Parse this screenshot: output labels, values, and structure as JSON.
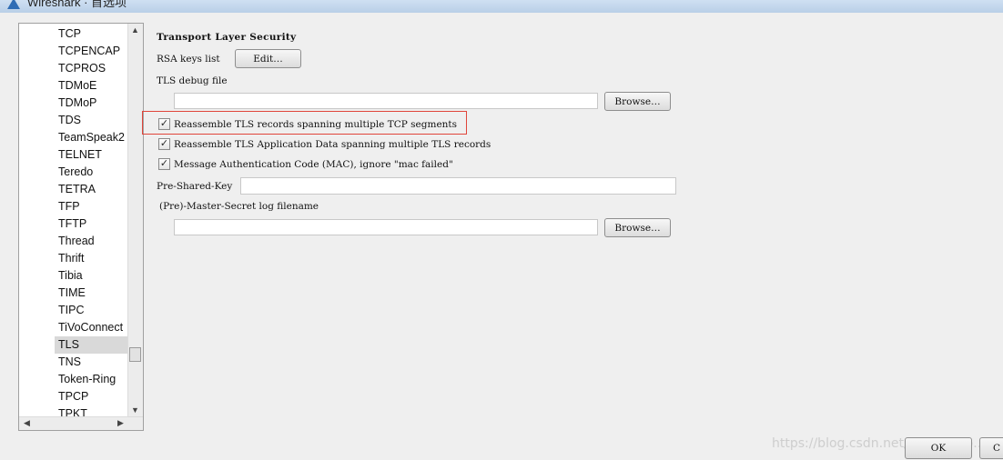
{
  "window": {
    "title": "Wireshark · 首选项"
  },
  "tree": {
    "items": [
      "TCP",
      "TCPENCAP",
      "TCPROS",
      "TDMoE",
      "TDMoP",
      "TDS",
      "TeamSpeak2",
      "TELNET",
      "Teredo",
      "TETRA",
      "TFP",
      "TFTP",
      "Thread",
      "Thrift",
      "Tibia",
      "TIME",
      "TIPC",
      "TiVoConnect",
      "TLS",
      "TNS",
      "Token-Ring",
      "TPCP",
      "TPKT"
    ],
    "selected": "TLS"
  },
  "panel": {
    "title": "Transport Layer Security",
    "rsa_label": "RSA keys list",
    "edit_button": "Edit…",
    "debug_file_label": "TLS debug file",
    "debug_file_value": "",
    "browse_button_1": "Browse…",
    "checkbox_1_label": "Reassemble TLS records spanning multiple TCP segments",
    "checkbox_1_checked": true,
    "checkbox_2_label": "Reassemble TLS Application Data spanning multiple TLS records",
    "checkbox_2_checked": true,
    "checkbox_3_label": "Message Authentication Code (MAC), ignore \"mac failed\"",
    "checkbox_3_checked": true,
    "psk_label": "Pre-Shared-Key",
    "psk_value": "",
    "master_secret_label": "(Pre)-Master-Secret log filename",
    "master_secret_value": "",
    "browse_button_2": "Browse…"
  },
  "footer": {
    "ok_button": "OK",
    "cancel_button": "C",
    "watermark": "https://blog.csdn.net/wangshuo…"
  },
  "colors": {
    "highlight": "#e0453a",
    "selected_row": "#d9d9d9"
  }
}
